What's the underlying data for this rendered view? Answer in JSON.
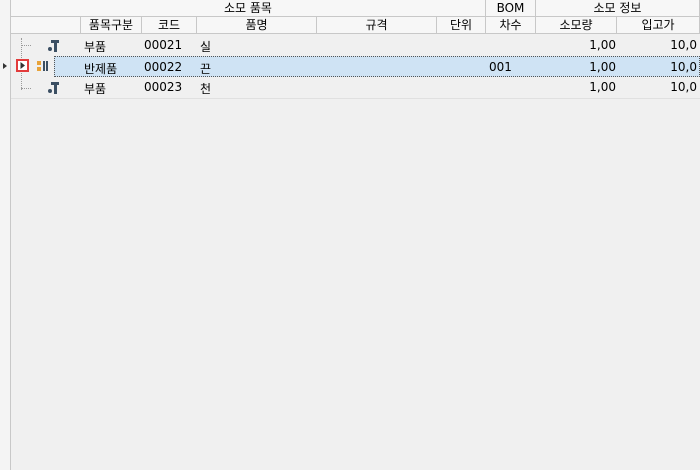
{
  "column_groups": {
    "consumed_item": "소모 품목",
    "bom": "BOM",
    "consume_info": "소모 정보"
  },
  "columns": {
    "item_type": "품목구분",
    "code": "코드",
    "item_name": "품명",
    "spec": "규격",
    "unit": "단위",
    "revision": "차수",
    "consumption": "소모량",
    "unit_price": "입고가"
  },
  "rows": [
    {
      "item_type": "부품",
      "code": "00021",
      "item_name": "실",
      "spec": "",
      "unit": "",
      "revision": "",
      "consumption": "1,00",
      "unit_price": "10,0",
      "icon": "part-icon"
    },
    {
      "item_type": "반제품",
      "code": "00022",
      "item_name": "끈",
      "spec": "",
      "unit": "",
      "revision": "001",
      "consumption": "1,00",
      "unit_price": "10,0",
      "icon": "semi-finished-icon",
      "selected": true
    },
    {
      "item_type": "부품",
      "code": "00023",
      "item_name": "천",
      "spec": "",
      "unit": "",
      "revision": "",
      "consumption": "1,00",
      "unit_price": "10,0",
      "icon": "part-icon"
    }
  ],
  "colors": {
    "selection": "#cfe3f4",
    "grid_line": "#c8c8c8",
    "expander_border": "#e23b3b",
    "semi_icon": "#e8a33a",
    "part_icon": "#3b4f63"
  }
}
